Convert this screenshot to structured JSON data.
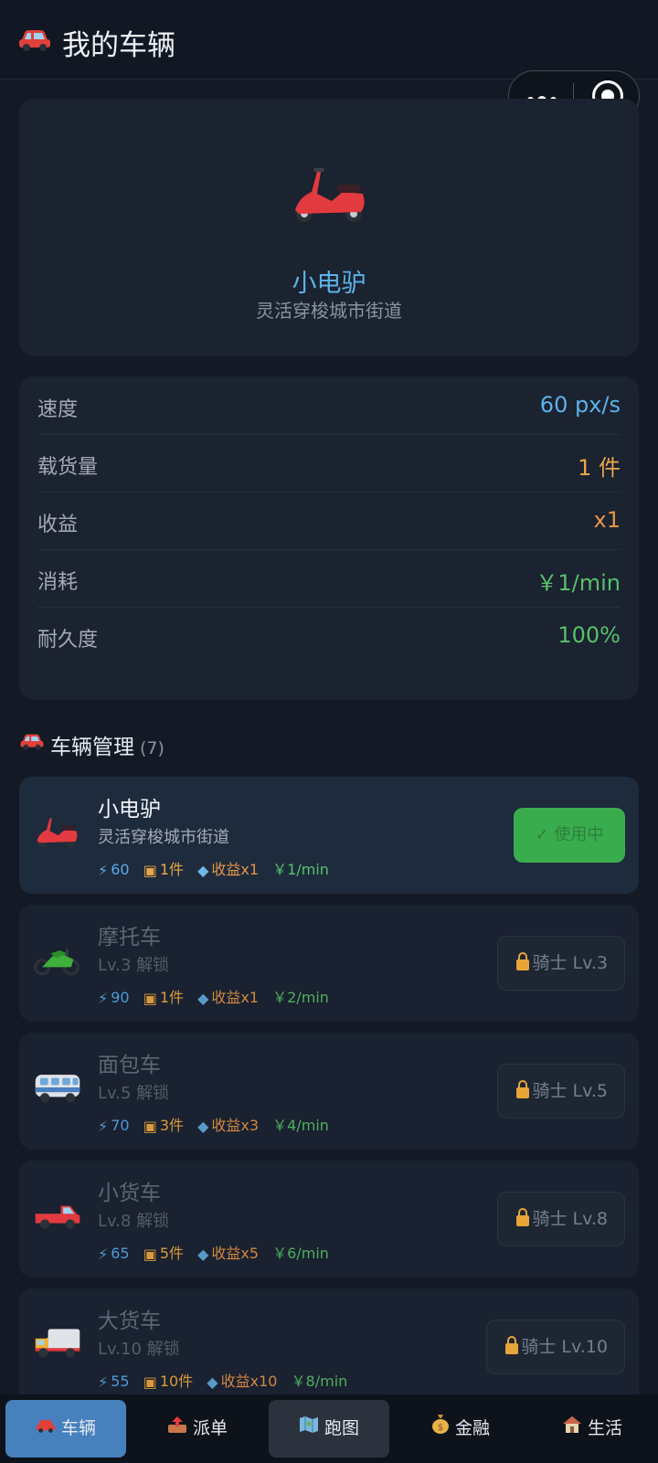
{
  "header": {
    "icon": "car-icon",
    "title": "我的车辆"
  },
  "capsule": {
    "more_icon": "more-dots-icon",
    "close_icon": "target-circle-icon"
  },
  "current": {
    "icon": "scooter-icon",
    "name": "小电驴",
    "desc": "灵活穿梭城市街道"
  },
  "stats": [
    {
      "label": "速度",
      "value": "60 px/s",
      "color": "#5bb3ea"
    },
    {
      "label": "载货量",
      "value": "1 件",
      "color": "#e8a84a"
    },
    {
      "label": "收益",
      "value": "x1",
      "color": "#e69548"
    },
    {
      "label": "消耗",
      "value": "￥1/min",
      "color": "#56c16a"
    },
    {
      "label": "耐久度",
      "value": "100%",
      "color": "#56c16a"
    }
  ],
  "section": {
    "title": "车辆管理",
    "count": "(7)"
  },
  "vehicles": [
    {
      "name": "小电驴",
      "sub": "灵活穿梭城市街道",
      "speed": "60",
      "cargo": "1件",
      "income": "收益x1",
      "cost": "￥1/min",
      "action": "✓ 使用中",
      "icon": "scooter-icon"
    },
    {
      "name": "摩托车",
      "sub": "Lv.3 解锁",
      "speed": "90",
      "cargo": "1件",
      "income": "收益x1",
      "cost": "￥2/min",
      "action": "骑士 Lv.3",
      "icon": "motorcycle-icon"
    },
    {
      "name": "面包车",
      "sub": "Lv.5 解锁",
      "speed": "70",
      "cargo": "3件",
      "income": "收益x3",
      "cost": "￥4/min",
      "action": "骑士 Lv.5",
      "icon": "minibus-icon"
    },
    {
      "name": "小货车",
      "sub": "Lv.8 解锁",
      "speed": "65",
      "cargo": "5件",
      "income": "收益x5",
      "cost": "￥6/min",
      "action": "骑士 Lv.8",
      "icon": "pickup-truck-icon"
    },
    {
      "name": "大货车",
      "sub": "Lv.10 解锁",
      "speed": "55",
      "cargo": "10件",
      "income": "收益x10",
      "cost": "￥8/min",
      "action": "骑士 Lv.10",
      "icon": "delivery-truck-icon"
    }
  ],
  "tabs": [
    {
      "label": "车辆",
      "icon": "car-icon"
    },
    {
      "label": "派单",
      "icon": "outbox-tray-icon"
    },
    {
      "label": "跑图",
      "icon": "map-icon"
    },
    {
      "label": "金融",
      "icon": "money-bag-icon"
    },
    {
      "label": "生活",
      "icon": "house-icon"
    }
  ]
}
